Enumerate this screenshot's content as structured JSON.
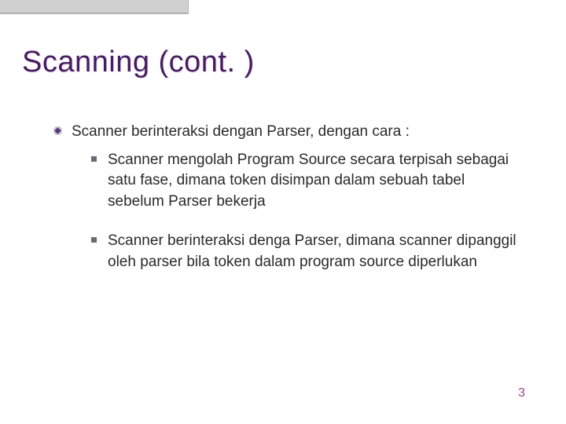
{
  "slide": {
    "title": "Scanning (cont. )",
    "main_point": "Scanner berinteraksi dengan Parser, dengan cara :",
    "sub_points": [
      "Scanner mengolah Program Source secara terpisah sebagai satu fase, dimana token disimpan dalam sebuah tabel sebelum Parser bekerja",
      "Scanner berinteraksi denga Parser, dimana scanner dipanggil oleh parser bila token dalam program source diperlukan"
    ],
    "page_number": "3"
  }
}
